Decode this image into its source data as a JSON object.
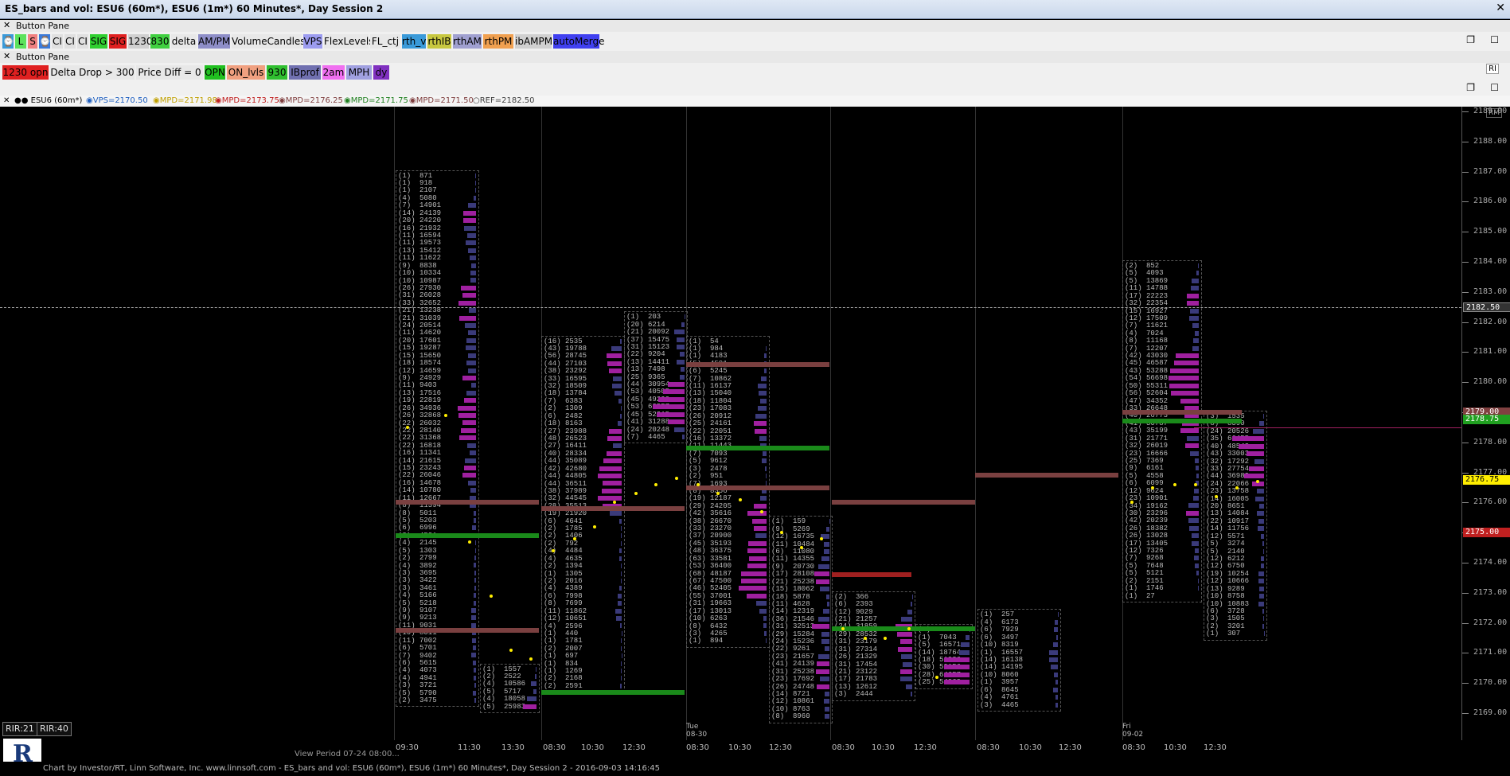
{
  "window": {
    "title": "ES_bars and vol: ESU6 (60m*), ESU6 (1m*) 60 Minutes*, Day Session 2",
    "close": "✕"
  },
  "pane1": {
    "name": "Button Pane",
    "close": "✕"
  },
  "pane2": {
    "name": "Button Pane",
    "close": "✕",
    "ri": "RI"
  },
  "row1_buttons": [
    {
      "label": "⌚",
      "bg": "#3a9ad9"
    },
    {
      "label": "L",
      "bg": "#5ce25c"
    },
    {
      "label": "S",
      "bg": "#f08080"
    },
    {
      "label": "⌚",
      "bg": "#3a7ad9"
    },
    {
      "label": "CI",
      "bg": "#e0e0e0"
    },
    {
      "label": "CI",
      "bg": "#e0e0e0"
    },
    {
      "label": "CI",
      "bg": "#e0e0e0"
    },
    {
      "label": "SIG",
      "bg": "#30d030"
    },
    {
      "label": "SIG",
      "bg": "#e02020"
    },
    {
      "label": "1230",
      "bg": "#d0d0d0"
    },
    {
      "label": "830",
      "bg": "#40d040"
    },
    {
      "label": "delta",
      "bg": "#e8e8e8"
    },
    {
      "label": "AM/PM",
      "bg": "#8e8ec8"
    },
    {
      "label": "VolumeCandles",
      "bg": "#e8e8e8"
    },
    {
      "label": "VPS",
      "bg": "#9c9cf0"
    },
    {
      "label": "FlexLevels",
      "bg": "#e8e8e8"
    },
    {
      "label": "FL_ctj",
      "bg": "#e8e8e8"
    },
    {
      "label": "rth_v",
      "bg": "#3a9ad9"
    },
    {
      "label": "rthIB",
      "bg": "#c8c840"
    },
    {
      "label": "rthAM",
      "bg": "#a0a0d0"
    },
    {
      "label": "rthPM",
      "bg": "#f0a050"
    },
    {
      "label": "ibAMPM",
      "bg": "#d0d0d0"
    },
    {
      "label": "autoMerge",
      "bg": "#4040f0"
    }
  ],
  "row2_buttons": [
    {
      "label": "1230 opn",
      "bg": "#e02020"
    },
    {
      "label": "Delta Drop > 300",
      "bg": "#e8e8e8"
    },
    {
      "label": "Price Diff = 0",
      "bg": "#e8e8e8"
    },
    {
      "label": "OPN",
      "bg": "#20c020"
    },
    {
      "label": "ON_lvls",
      "bg": "#f0a080"
    },
    {
      "label": "930",
      "bg": "#30c030"
    },
    {
      "label": "IBprof",
      "bg": "#7070b0"
    },
    {
      "label": "2am",
      "bg": "#f070f0"
    },
    {
      "label": "MPH",
      "bg": "#a0a0e0"
    },
    {
      "label": "dy",
      "bg": "#8030c0"
    }
  ],
  "legend": {
    "close": "✕",
    "items": [
      {
        "text": "●● ESU6 (60m*)",
        "color": "#000"
      },
      {
        "text": "◉VPS=2170.50",
        "color": "#2060c0"
      },
      {
        "text": "◉MPD=2171.98",
        "color": "#c0a000"
      },
      {
        "text": "◉MPD=2173.75",
        "color": "#c02020"
      },
      {
        "text": "◉MPD=2176.25",
        "color": "#804040"
      },
      {
        "text": "◉MPD=2171.75",
        "color": "#208020"
      },
      {
        "text": "◉MPD=2171.50",
        "color": "#804040"
      },
      {
        "text": "○REF=2182.50",
        "color": "#404040"
      }
    ]
  },
  "rm": "RM",
  "yaxis": {
    "ticks": [
      "2189.00",
      "2188.00",
      "2187.00",
      "2186.00",
      "2185.00",
      "2184.00",
      "2183.00",
      "2182.00",
      "2181.00",
      "2180.00",
      "2179.00",
      "2178.00",
      "2177.00",
      "2176.00",
      "2175.00",
      "2174.00",
      "2173.00",
      "2172.00",
      "2171.00",
      "2170.00",
      "2169.00"
    ],
    "ref_label": "2182.50",
    "markers": [
      {
        "label": "2179.00",
        "bg": "#804040"
      },
      {
        "label": "2178.75",
        "bg": "#20a020"
      },
      {
        "label": "2176.75",
        "bg": "#ffee00"
      },
      {
        "label": "2175.00",
        "bg": "#c02020"
      }
    ]
  },
  "xaxis": {
    "labels": [
      "09:30",
      "11:30",
      "13:30",
      "08:30",
      "10:30",
      "12:30",
      "08:30",
      "10:30",
      "12:30",
      "08:30",
      "10:30",
      "12:30",
      "08:30",
      "10:30",
      "12:30",
      "08:30",
      "10:30",
      "12:30"
    ],
    "day_labels": [
      {
        "day": "Tue",
        "date": "08-30"
      },
      {
        "day": "Fri",
        "date": "09-02"
      }
    ],
    "view_period": "View Period 07-24 08:00..."
  },
  "rir": [
    "RIR:21",
    "RIR:40"
  ],
  "footer": "Chart by Investor/RT, Linn Software, Inc. www.linnsoft.com - ES_bars and vol: ESU6 (60m*), ESU6 (1m*) 60 Minutes*, Day Session 2 - 2016-09-03 14:16:45",
  "profiles": [
    {
      "text": "(1)  871\n(1)  918\n(1)  2107\n(4)  5080\n(7)  14901\n(14) 24139\n(20) 24220\n(16) 21932\n(11) 16594\n(11) 19573\n(13) 15412\n(11) 11622\n(9)  8838\n(10) 10334\n(10) 10987\n(26) 27930\n(31) 26028\n(33) 32652\n(21) 13238\n(21) 31039\n(24) 20514\n(11) 14620\n(20) 17601\n(15) 19287\n(15) 15650\n(18) 18574\n(12) 14659\n(9)  24929\n(11) 9403\n(13) 17516\n(19) 22819\n(26) 34936\n(26) 32868\n(22) 26032\n(22) 28140\n(22) 31368\n(22) 16818\n(16) 11341\n(14) 21615\n(15) 23243\n(22) 26046\n(16) 14678\n(14) 10780\n(11) 12667\n(8)  11394\n(8)  5011\n(5)  5203\n(6)  6996\n(3)  4521\n(4)  2145\n(5)  1303\n(2)  2799\n(4)  3892\n(3)  3695\n(3)  3422\n(3)  3461\n(4)  5166\n(5)  5218\n(9)  9107\n(9)  9213\n(11) 9031\n(10) 8011\n(11) 7002\n(6)  5701\n(7)  9402\n(6)  5615\n(4)  4073\n(4)  4941\n(3)  3721\n(5)  5790\n(2)  3475"
    },
    {
      "text": "(16) 2535\n(43) 19788\n(56) 28745\n(44) 27103\n(38) 23292\n(33) 16595\n(32) 18509\n(18) 13784\n(7)  6383\n(2)  1309\n(6)  2482\n(18) 8163\n(27) 23988\n(48) 26523\n(27) 16411\n(40) 28334\n(44) 35089\n(42) 42680\n(44) 44805\n(44) 36511\n(38) 37989\n(32) 44545\n(28) 35513\n(19) 21920\n(6)  4641\n(2)  1785\n(2)  1406\n(2)  792\n(4)  4484\n(4)  4635\n(2)  1394\n(1)  1305\n(2)  2016\n(4)  4389\n(6)  7998\n(8)  7699\n(11) 11862\n(12) 10651\n(4)  2596\n(1)  440\n(1)  1781\n(2)  2007\n(1)  697\n(1)  834\n(1)  1269\n(2)  2168\n(2)  2591"
    },
    {
      "text": "(1)  203\n(20) 6214\n(21) 20092\n(37) 15475\n(31) 15123\n(22) 9204\n(13) 14411\n(13) 7498\n(25) 9365\n(44) 30954\n(53) 40505\n(45) 49298\n(53) 62557\n(45) 52315\n(41) 31288\n(24) 20248\n(7)  4465"
    },
    {
      "text": "(1)  54\n(1)  984\n(1)  4183\n(5)  4591\n(6)  5245\n(7)  10862\n(11) 16137\n(13) 15040\n(18) 11804\n(23) 17083\n(26) 20912\n(25) 24161\n(22) 22051\n(16) 13372\n(11) 11443\n(7)  7093\n(5)  9612\n(3)  2478\n(2)  951\n(7)  1693\n(8)  8356\n(19) 12187\n(29) 24205\n(42) 35616\n(38) 26670\n(33) 23270\n(37) 20900\n(45) 35193\n(48) 36375\n(63) 33581\n(53) 36400\n(68) 48187\n(67) 47500\n(46) 52405\n(55) 37001\n(31) 19663\n(17) 13013\n(10) 6263\n(8)  6432\n(3)  4265\n(1)  894"
    },
    {
      "text": "(1)  159\n(9)  5269\n(12) 16735\n(11) 10484\n(6)  11080\n(11) 14355\n(9)  20730\n(17) 28108\n(21) 25238\n(15) 18062\n(18) 5878\n(11) 4628\n(14) 12319\n(36) 21546\n(31) 32513\n(29) 15284\n(24) 15236\n(22) 9261\n(23) 21657\n(41) 24139\n(31) 25238\n(23) 17692\n(26) 24748\n(14) 8721\n(12) 10861\n(10) 8763\n(8)  8960"
    },
    {
      "text": "(2)  366\n(6)  2393\n(12) 9029\n(21) 21257\n(24) 31859\n(29) 28532\n(31) 23179\n(31) 27314\n(26) 21329\n(31) 17454\n(21) 23122\n(17) 21783\n(13) 12612\n(3)  2444"
    },
    {
      "text": "(1)  723\n(1)  7043\n(5)  16571\n(14) 18764\n(18) 51936\n(30) 50156\n(28) 64657\n(25) 54060"
    },
    {
      "text": "(1)  257\n(4)  6173\n(6)  7929\n(6)  3497\n(10) 8319\n(1)  16557\n(14) 16138\n(14) 14195\n(10) 8060\n(1)  3957\n(6)  8645\n(4)  4761\n(3)  4465"
    },
    {
      "text": "(2)  852\n(5)  4093\n(5)  13869\n(11) 14788\n(17) 22223\n(32) 22354\n(15) 16927\n(12) 17509\n(7)  11621\n(4)  7024\n(8)  11168\n(7)  12207\n(42) 43030\n(45) 46587\n(43) 53288\n(54) 56698\n(50) 55311\n(56) 52604\n(47) 34352\n(33) 26648\n(40) 26773\n(41) 30787\n(43) 35199\n(31) 21771\n(32) 26019\n(23) 16666\n(25) 7369\n(9)  6161\n(5)  4558\n(6)  6099\n(12) 9624\n(23) 10901\n(34) 19162\n(30) 23296\n(42) 20239\n(26) 18382\n(26) 13028\n(17) 13405\n(12) 7326\n(7)  9268\n(5)  7648\n(5)  5121\n(2)  2151\n(1)  1746\n(1)  27"
    },
    {
      "text": "(3)  1535\n(8)  8390\n(24) 20526\n(35) 66455\n(40) 48543\n(43) 33003\n(32) 17292\n(33) 27754\n(44) 36989\n(24) 22066\n(23) 13758\n(14) 16005\n(20) 8651\n(13) 14084\n(22) 10917\n(14) 11756\n(12) 5571\n(5)  3274\n(5)  2140\n(12) 6212\n(12) 6750\n(19) 10254\n(12) 10666\n(13) 9289\n(10) 8758\n(10) 10883\n(6)  3728\n(3)  1505\n(2)  3201\n(1)  307"
    },
    {
      "text": "(1)  1557\n(2)  2522\n(4)  10586\n(5)  5717\n(4)  18058\n(5)  25983"
    }
  ]
}
